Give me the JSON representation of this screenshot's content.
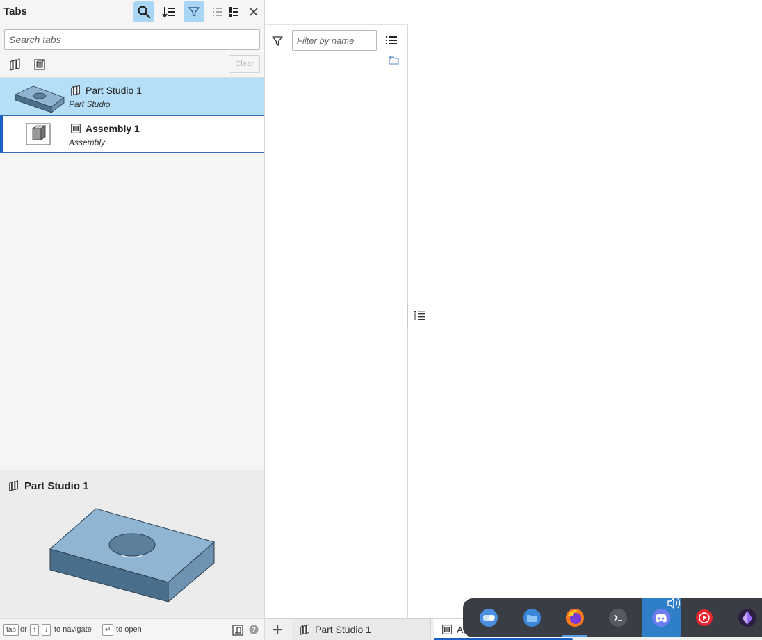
{
  "tabs_panel": {
    "title": "Tabs",
    "search_placeholder": "Search tabs",
    "clear_label": "Clear",
    "items": [
      {
        "name": "Part Studio 1",
        "type": "Part Studio",
        "selected": true
      },
      {
        "name": "Assembly 1",
        "type": "Assembly",
        "active": true
      }
    ],
    "preview": {
      "title": "Part Studio 1"
    },
    "footer": {
      "key_tab": "tab",
      "or": "or",
      "key_up": "↑",
      "key_down": "↓",
      "navigate": "to navigate",
      "key_enter": "↵",
      "open": "to open"
    }
  },
  "filter_panel": {
    "filter_placeholder": "Filter by name"
  },
  "bottom_tabs": [
    {
      "label": "Part Studio 1"
    },
    {
      "label": "As"
    }
  ],
  "colors": {
    "selected_row": "#b5dff9",
    "active_header_button": "#a9d6f5",
    "accent_blue": "#1a5fc7",
    "part_face": "#8fb5d3",
    "part_side": "#4a6f8c",
    "dock_bg": "#3a3d44"
  },
  "dock": {
    "apps": [
      "toggle-app-icon",
      "files-icon",
      "firefox-icon",
      "terminal-icon",
      "discord-icon",
      "youtube-music-icon",
      "crystal-app-icon"
    ]
  }
}
